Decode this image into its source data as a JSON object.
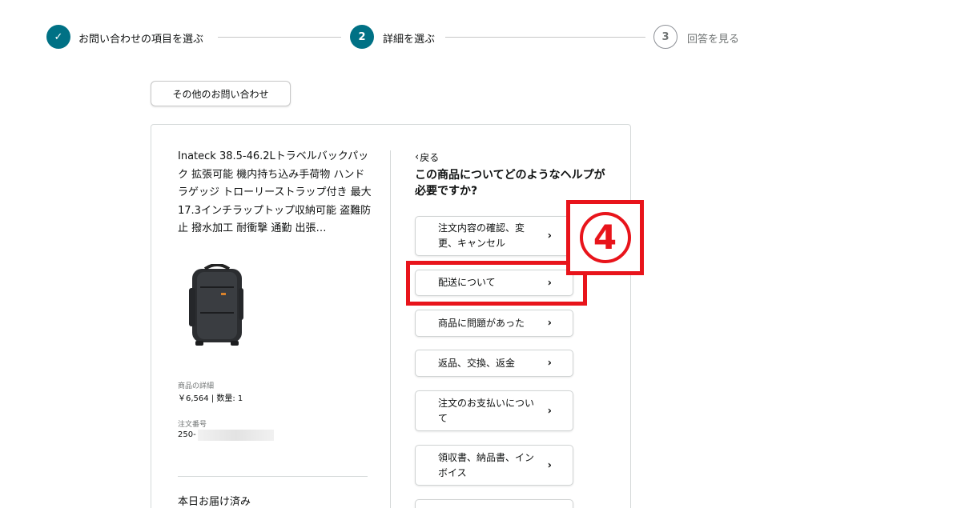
{
  "stepper": {
    "steps": [
      {
        "number": "✓",
        "label": "お問い合わせの項目を選ぶ",
        "state": "done"
      },
      {
        "number": "2",
        "label": "詳細を選ぶ",
        "state": "active"
      },
      {
        "number": "3",
        "label": "回答を見る",
        "state": "todo"
      }
    ]
  },
  "other_inquiry_button": "その他のお問い合わせ",
  "product": {
    "title": "Inateck 38.5-46.2Lトラベルバックパック 拡張可能 機内持ち込み手荷物 ハンドラゲッジ トローリーストラップ付き 最大17.3インチラップトップ収納可能 盗難防止 撥水加工 耐衝撃 通勤 出張…",
    "details_label": "商品の詳細",
    "price_qty": "￥6,564 | 数量: 1",
    "order_label": "注文番号",
    "order_number": "250-",
    "delivery_status": "本日お届け済み"
  },
  "help": {
    "back_label": "戻る",
    "question": "この商品についてどのようなヘルプが必要ですか?",
    "options": [
      "注文内容の確認、変更、キャンセル",
      "配送について",
      "商品に問題があった",
      "返品、交換、返金",
      "注文のお支払いについて",
      "領収書、納品書、インボイス"
    ]
  },
  "annotation": {
    "callout_number": "④",
    "color": "#e8141b"
  },
  "colors": {
    "accent": "#007185"
  }
}
